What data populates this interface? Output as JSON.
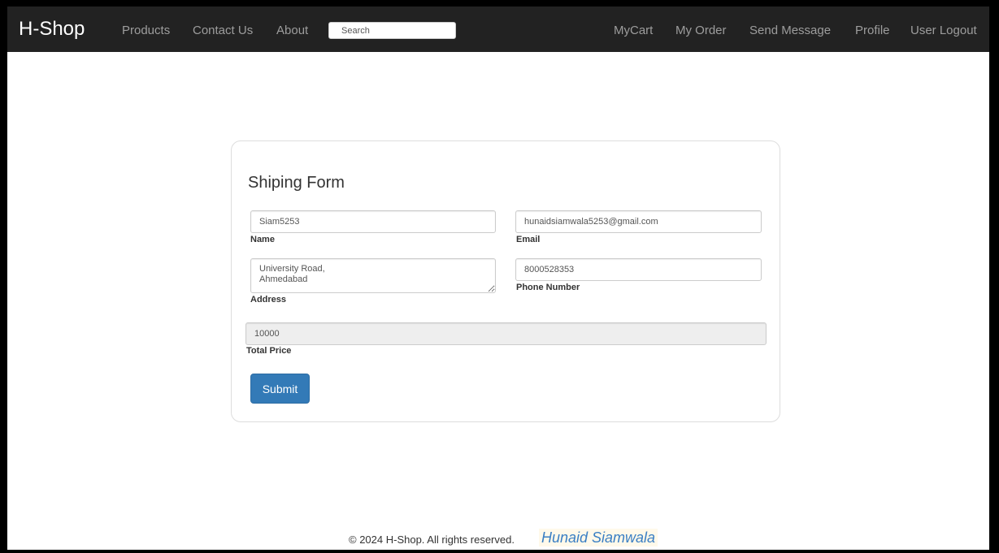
{
  "navbar": {
    "brand": "H-Shop",
    "left_links": [
      "Products",
      "Contact Us",
      "About"
    ],
    "search_placeholder": "Search",
    "right_links": [
      "MyCart",
      "My Order",
      "Send Message",
      "Profile",
      "User Logout"
    ]
  },
  "form": {
    "title": "Shiping Form",
    "name": {
      "value": "Siam5253",
      "label": "Name"
    },
    "email": {
      "value": "hunaidsiamwala5253@gmail.com",
      "label": "Email"
    },
    "address": {
      "value": "University Road,\nAhmedabad",
      "label": "Address"
    },
    "phone": {
      "value": "8000528353",
      "label": "Phone Number"
    },
    "total_price": {
      "value": "10000",
      "label": "Total Price"
    },
    "submit_label": "Submit"
  },
  "footer": {
    "copyright": "© 2024 H-Shop. All rights reserved.",
    "author": "Hunaid Siamwala"
  },
  "colors": {
    "navbar_bg": "#222222",
    "primary_button": "#337ab7",
    "author_link": "#3a7fc4"
  }
}
